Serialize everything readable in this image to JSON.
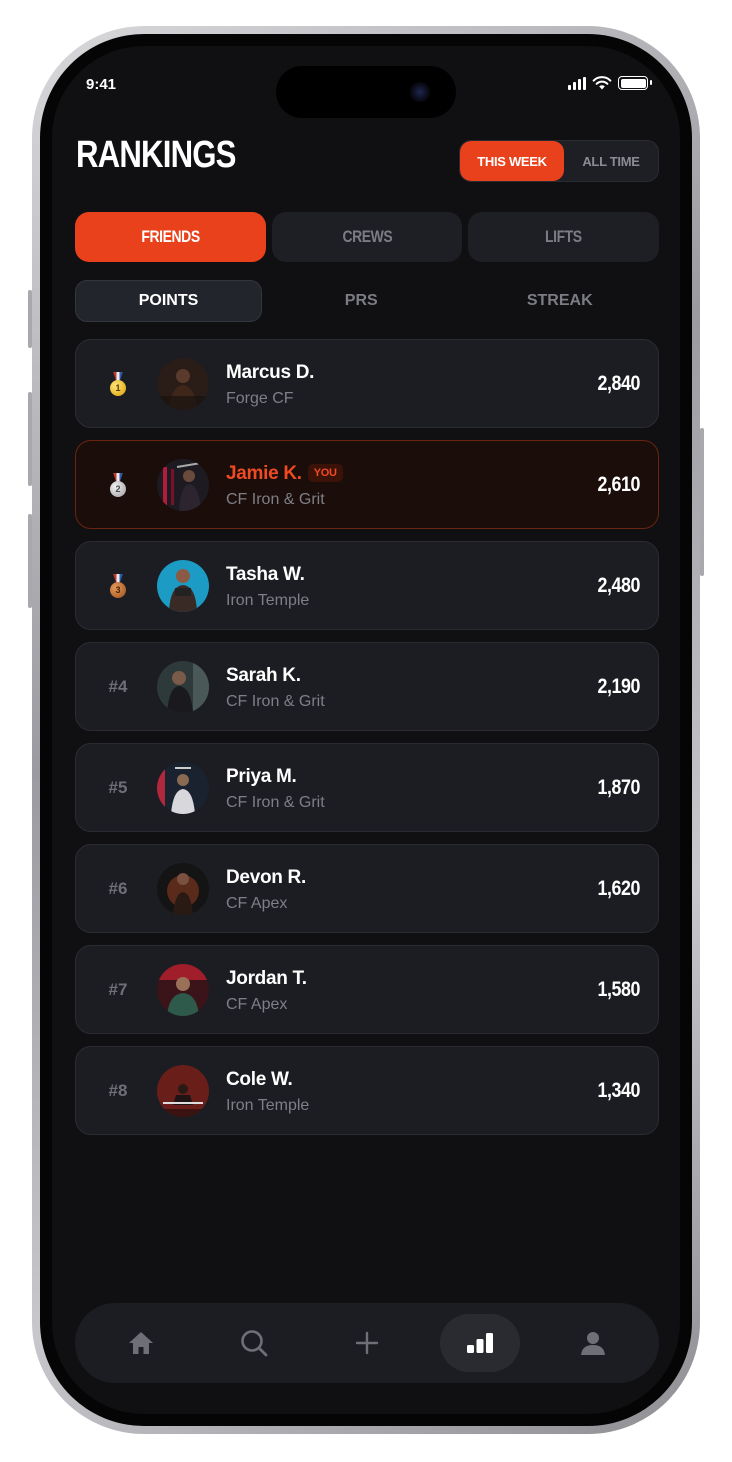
{
  "status_bar": {
    "time": "9:41"
  },
  "header": {
    "title": "RANKINGS"
  },
  "period_toggle": [
    {
      "label": "THIS WEEK",
      "active": true
    },
    {
      "label": "ALL TIME",
      "active": false
    }
  ],
  "category_tabs": [
    {
      "label": "FRIENDS",
      "active": true
    },
    {
      "label": "CREWS",
      "active": false
    },
    {
      "label": "LIFTS",
      "active": false
    }
  ],
  "metric_tabs": [
    {
      "label": "POINTS",
      "active": true
    },
    {
      "label": "PRS",
      "active": false
    },
    {
      "label": "STREAK",
      "active": false
    }
  ],
  "leaderboard": [
    {
      "rank": "1",
      "medal": "gold-medal-icon",
      "name": "Marcus D.",
      "gym": "Forge CF",
      "score": "2,840"
    },
    {
      "rank": "2",
      "medal": "silver-medal-icon",
      "name": "Jamie K.",
      "badge": "YOU",
      "gym": "CF Iron & Grit",
      "score": "2,610",
      "is_me": true
    },
    {
      "rank": "3",
      "medal": "bronze-medal-icon",
      "name": "Tasha W.",
      "gym": "Iron Temple",
      "score": "2,480"
    },
    {
      "rank": "#4",
      "name": "Sarah K.",
      "gym": "CF Iron & Grit",
      "score": "2,190"
    },
    {
      "rank": "#5",
      "name": "Priya M.",
      "gym": "CF Iron & Grit",
      "score": "1,870"
    },
    {
      "rank": "#6",
      "name": "Devon R.",
      "gym": "CF Apex",
      "score": "1,620"
    },
    {
      "rank": "#7",
      "name": "Jordan T.",
      "gym": "CF Apex",
      "score": "1,580"
    },
    {
      "rank": "#8",
      "name": "Cole W.",
      "gym": "Iron Temple",
      "score": "1,340"
    }
  ],
  "bottom_nav": [
    {
      "icon": "home-icon",
      "active": false
    },
    {
      "icon": "search-icon",
      "active": false
    },
    {
      "icon": "plus-icon",
      "active": false
    },
    {
      "icon": "leaderboard-icon",
      "active": true
    },
    {
      "icon": "profile-icon",
      "active": false
    }
  ],
  "colors": {
    "accent": "#e8411b",
    "background": "#101013",
    "card": "#1c1d22"
  }
}
